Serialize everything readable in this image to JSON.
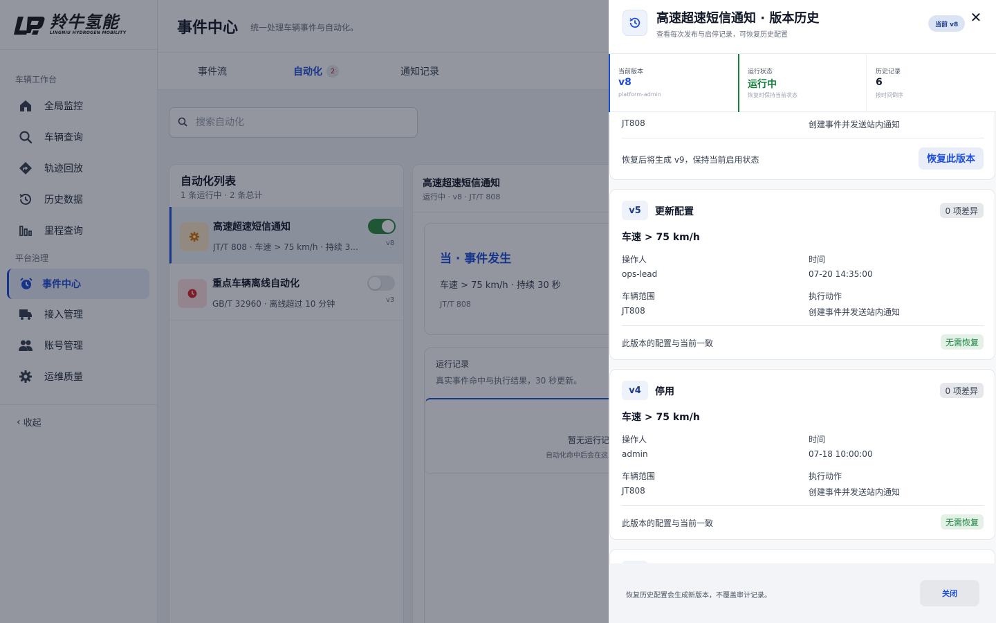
{
  "brand": {
    "name_cn": "羚牛氢能",
    "name_en": "LINGNIU HYDROGEN MOBILITY"
  },
  "sidebar": {
    "group_workbench": "车辆工作台",
    "group_platform": "平台治理",
    "items": [
      {
        "label": "全局监控",
        "icon": "home-icon"
      },
      {
        "label": "车辆查询",
        "icon": "search-icon"
      },
      {
        "label": "轨迹回放",
        "icon": "route-icon"
      },
      {
        "label": "历史数据",
        "icon": "history-icon"
      },
      {
        "label": "里程查询",
        "icon": "bar-chart-icon"
      },
      {
        "label": "事件中心",
        "icon": "alarm-clock-icon"
      },
      {
        "label": "接入管理",
        "icon": "truck-icon"
      },
      {
        "label": "账号管理",
        "icon": "users-icon"
      },
      {
        "label": "运维质量",
        "icon": "gear-icon"
      }
    ],
    "collapse_label": "收起"
  },
  "header": {
    "title": "事件中心",
    "subtitle": "统一处理车辆事件与自动化。"
  },
  "tabs": [
    {
      "label": "事件流"
    },
    {
      "label": "自动化",
      "badge": "2"
    },
    {
      "label": "通知记录"
    }
  ],
  "search": {
    "placeholder": "搜索自动化"
  },
  "automation_list": {
    "title": "自动化列表",
    "summary": "1 条运行中 · 2 条总计",
    "items": [
      {
        "name": "高速超速短信通知",
        "desc": "JT/T 808 · 车速 > 75 km/h · 持续 3...",
        "version": "v8",
        "enabled": true
      },
      {
        "name": "重点车辆离线自动化",
        "desc": "GB/T 32960 · 离线超过 10 分钟",
        "version": "v3",
        "enabled": false
      }
    ]
  },
  "detail": {
    "title": "高速超速短信通知",
    "meta": "运行中 · v8 · JT/T 808",
    "trigger_title": "当 · 事件发生",
    "trigger_condition": "车速 > 75 km/h · 持续 30 秒",
    "trigger_protocol": "JT/T 808",
    "runs_title": "运行记录",
    "runs_subtitle": "真实事件命中与执行结果，30 秒更新。",
    "runs_empty": "暂无运行记",
    "runs_empty_hint": "自动化命中后会在这里显"
  },
  "drawer": {
    "title": "高速超速短信通知 · 版本历史",
    "subtitle": "查看每次发布与启停记录，可恢复历史配置",
    "current_badge": "当前 v8",
    "stats": [
      {
        "label": "当前版本",
        "value": "v8",
        "hint": "platform-admin",
        "color": "#1d4ed8"
      },
      {
        "label": "运行状态",
        "value": "运行中",
        "hint": "恢复时保持当前状态",
        "color": "#15803d"
      },
      {
        "label": "历史记录",
        "value": "6",
        "hint": "按时间倒序",
        "color": "#111827"
      }
    ],
    "partial_card": {
      "scope": "JT808",
      "action": "创建事件并发送站内通知",
      "note": "恢复后将生成 v9，保持当前启用状态",
      "restore_label": "恢复此版本"
    },
    "versions": [
      {
        "tag": "v5",
        "type": "更新配置",
        "diff": "0 项差异",
        "condition": "车速 > 75 km/h",
        "operator_label": "操作人",
        "operator": "ops-lead",
        "time_label": "时间",
        "time": "07-20 14:35:00",
        "scope_label": "车辆范围",
        "scope": "JT808",
        "action_label": "执行动作",
        "action": "创建事件并发送站内通知",
        "note": "此版本的配置与当前一致",
        "status": "无需恢复"
      },
      {
        "tag": "v4",
        "type": "停用",
        "diff": "0 项差异",
        "condition": "车速 > 75 km/h",
        "operator_label": "操作人",
        "operator": "admin",
        "time_label": "时间",
        "time": "07-18 10:00:00",
        "scope_label": "车辆范围",
        "scope": "JT808",
        "action_label": "执行动作",
        "action": "创建事件并发送站内通知",
        "note": "此版本的配置与当前一致",
        "status": "无需恢复"
      }
    ],
    "footer_note": "恢复历史配置会生成新版本，不覆盖审计记录。",
    "close_label": "关闭"
  },
  "colors": {
    "accent": "#1d4ed8",
    "success": "#15803d",
    "toggle_on": "#2e8b3e"
  }
}
